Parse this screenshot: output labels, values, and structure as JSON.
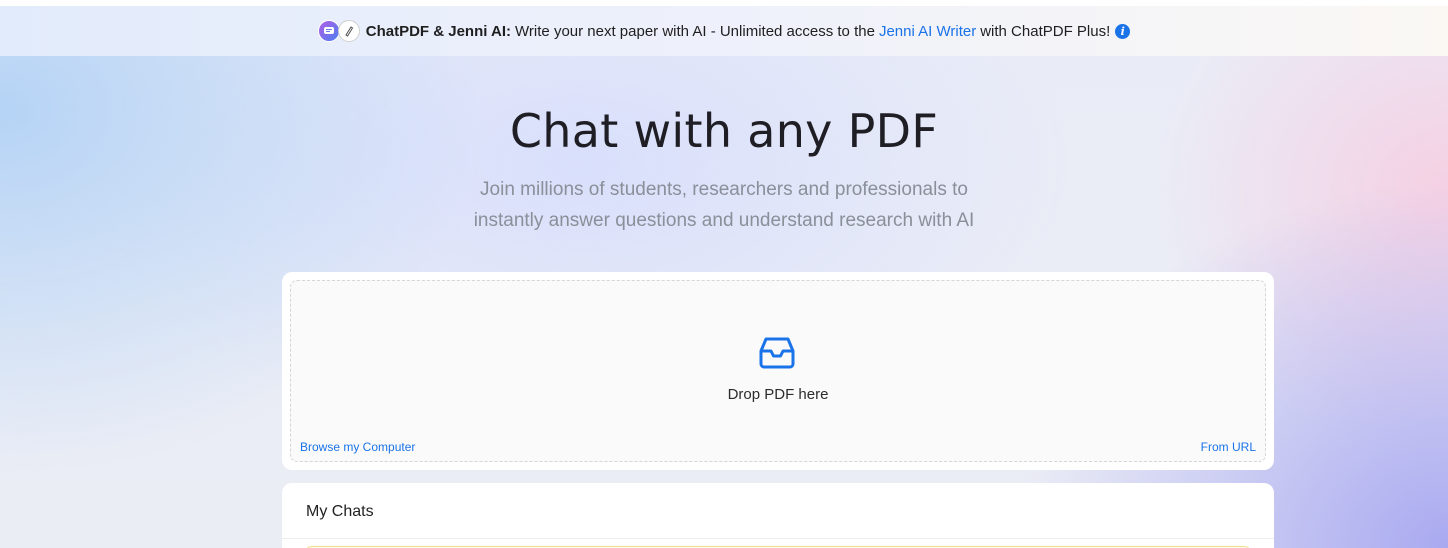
{
  "banner": {
    "brand_label": "ChatPDF & Jenni AI:",
    "text_before_link": "Write your next paper with AI - Unlimited access to the",
    "link_text": "Jenni AI Writer",
    "text_after_link": "with ChatPDF Plus!",
    "icons": [
      "chatpdf-logo-icon",
      "jenni-logo-icon",
      "info-icon"
    ],
    "info_glyph": "i"
  },
  "hero": {
    "title": "Chat with any PDF",
    "subtitle_line1": "Join millions of students, researchers and professionals to",
    "subtitle_line2": "instantly answer questions and understand research with AI"
  },
  "upload": {
    "icon": "inbox-icon",
    "drop_label": "Drop PDF here",
    "browse_label": "Browse my Computer",
    "url_label": "From URL"
  },
  "chats": {
    "title": "My Chats"
  },
  "colors": {
    "accent": "#1a73e8",
    "title_text": "#1e1e24",
    "subtitle_text": "#8a8f99"
  }
}
